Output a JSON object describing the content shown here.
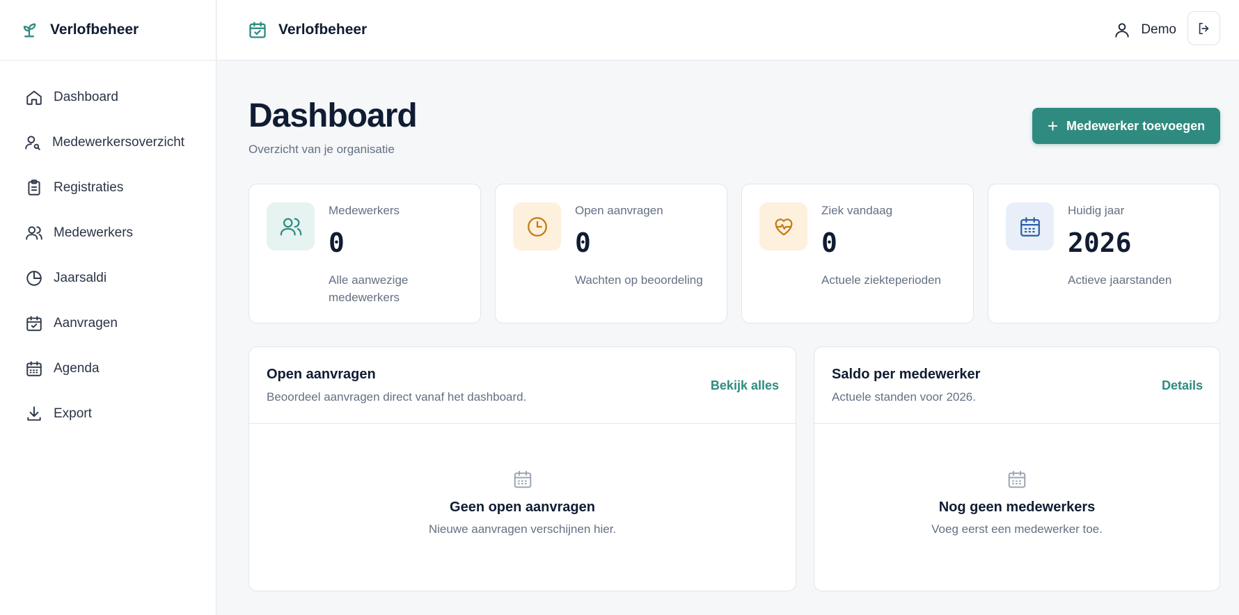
{
  "app": {
    "name": "Verlofbeheer"
  },
  "sidebar": {
    "items": [
      {
        "label": "Dashboard",
        "icon": "home-icon"
      },
      {
        "label": "Medewerkersoverzicht",
        "icon": "user-overview-icon"
      },
      {
        "label": "Registraties",
        "icon": "clipboard-icon"
      },
      {
        "label": "Medewerkers",
        "icon": "users-icon"
      },
      {
        "label": "Jaarsaldi",
        "icon": "pie-chart-icon"
      },
      {
        "label": "Aanvragen",
        "icon": "calendar-check-icon"
      },
      {
        "label": "Agenda",
        "icon": "calendar-icon"
      },
      {
        "label": "Export",
        "icon": "download-icon"
      }
    ]
  },
  "topbar": {
    "title": "Verlofbeheer",
    "user": "Demo"
  },
  "page": {
    "title": "Dashboard",
    "subtitle": "Overzicht van je organisatie",
    "add_button": "Medewerker toevoegen"
  },
  "stats": [
    {
      "label": "Medewerkers",
      "value": "0",
      "desc": "Alle aanwezige medewerkers",
      "icon": "users-icon",
      "color": "#2f8b7f",
      "bg": "#e6f3f1"
    },
    {
      "label": "Open aanvragen",
      "value": "0",
      "desc": "Wachten op beoordeling",
      "icon": "clock-icon",
      "color": "#c47a12",
      "bg": "#fdf0dd"
    },
    {
      "label": "Ziek vandaag",
      "value": "0",
      "desc": "Actuele ziekteperioden",
      "icon": "heart-pulse-icon",
      "color": "#c47a12",
      "bg": "#fdf0dd"
    },
    {
      "label": "Huidig jaar",
      "value": "2026",
      "desc": "Actieve jaarstanden",
      "icon": "calendar-icon",
      "color": "#2b5fa8",
      "bg": "#e8eff9"
    }
  ],
  "panels": {
    "open": {
      "title": "Open aanvragen",
      "subtitle": "Beoordeel aanvragen direct vanaf het dashboard.",
      "link": "Bekijk alles",
      "empty_title": "Geen open aanvragen",
      "empty_desc": "Nieuwe aanvragen verschijnen hier."
    },
    "saldo": {
      "title": "Saldo per medewerker",
      "subtitle": "Actuele standen voor 2026.",
      "link": "Details",
      "empty_title": "Nog geen medewerkers",
      "empty_desc": "Voeg eerst een medewerker toe."
    }
  }
}
